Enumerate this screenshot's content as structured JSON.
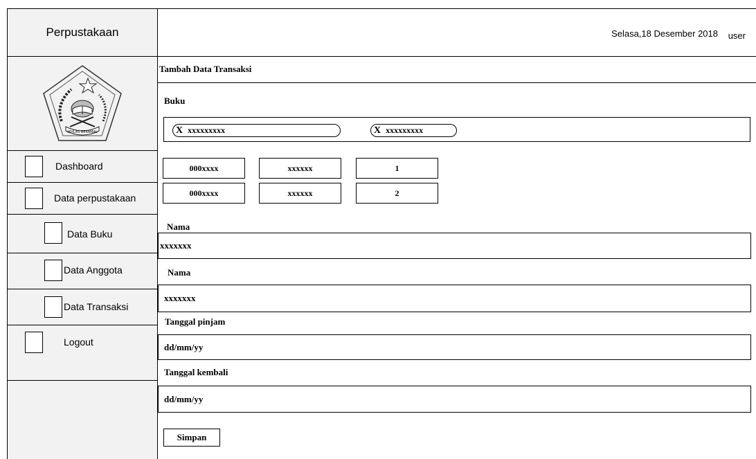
{
  "app": {
    "title": "Perpustakaan"
  },
  "header": {
    "date": "Selasa,18 Desember 2018",
    "user": "user"
  },
  "sidebar": {
    "items": [
      {
        "label": "Dashboard"
      },
      {
        "label": "Data perpustakaan"
      },
      {
        "label": "Data Buku"
      },
      {
        "label": "Data Anggota"
      },
      {
        "label": "Data Transaksi"
      },
      {
        "label": "Logout"
      }
    ]
  },
  "logo": {
    "icon": "ministry-emblem-icon",
    "banner": "IKHLAS BERAMAL"
  },
  "form": {
    "title": "Tambah Data Transaksi",
    "buku_label": "Buku",
    "chips": [
      {
        "x": "X",
        "text": "xxxxxxxxx"
      },
      {
        "x": "X",
        "text": "xxxxxxxxx"
      }
    ],
    "rows": [
      [
        "000xxxx",
        "xxxxxx",
        "1"
      ],
      [
        "000xxxx",
        "xxxxxx",
        "2"
      ]
    ],
    "nama_label_1": "Nama",
    "nama_value_1": "xxxxxxx",
    "nama_label_2": "Nama",
    "nama_value_2": "xxxxxxx",
    "tanggal_pinjam_label": "Tanggal pinjam",
    "tanggal_pinjam_value": "dd/mm/yy",
    "tanggal_kembali_label": "Tanggal kembali",
    "tanggal_kembali_value": "dd/mm/yy",
    "save_label": "Simpan"
  }
}
